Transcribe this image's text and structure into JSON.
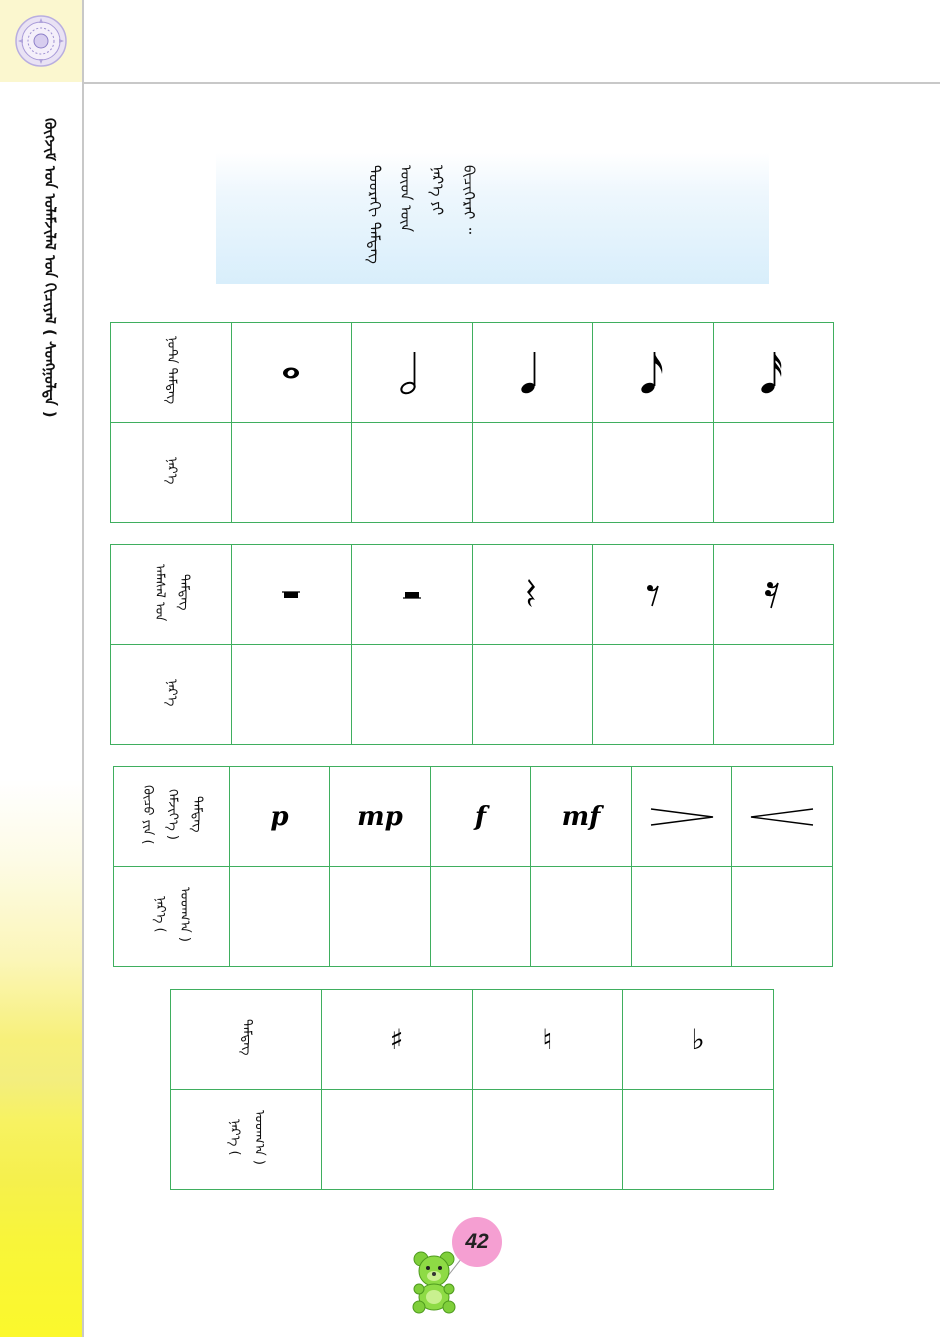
{
  "page": {
    "side_title": "ᠬᠥᠭᠵᠢᠮ ᠤᠨ ᠤᠯᠠᠮᠵᠢᠯᠠᠯ ᠤᠨ ᠬᠢᠴᠢᠶᠡᠯ ( ᠰᠣᠩᠭᠣᠯᠲᠠ )",
    "instruction": "ᠳᠣᠣᠷᠠᠬᠢ ᠲᠡᠮᠳᠡᠭ ᠦᠳ ᠦᠨ ᠨᠡᠷ᠎ᠡ ᠶᠢ ᠪᠢᠴᠢᠭᠡᠷᠡᠢ ᠃",
    "page_number": "42",
    "accent_color": "#3fae5e",
    "badge_color": "#f59fd2"
  },
  "tables": {
    "notes": {
      "header_label": "ᠨᠤᠲ᠋ᠠ ᠲᠡᠮᠳᠡᠭ",
      "name_label": "ᠨᠡᠷ᠎ᠡ",
      "symbols": [
        "whole-note",
        "half-note",
        "quarter-note",
        "eighth-note",
        "sixteenth-note"
      ]
    },
    "rests": {
      "header_label": "ᠠᠮᠠᠰᠠᠯ ᠤᠨ ᠲᠡᠮᠳᠡᠭ",
      "name_label": "ᠨᠡᠷ᠎ᠡ",
      "symbols": [
        "whole-rest",
        "half-rest",
        "quarter-rest",
        "eighth-rest",
        "sixteenth-rest"
      ]
    },
    "dynamics": {
      "header_label": "ᠬᠦᠴᠦ ᠶᠢᠨ ( ᠬᠡᠮᠵᠢᠶ᠎ᠡ ) ᠲᠡᠮᠳᠡᠭ",
      "name_label": "ᠨᠡᠷ᠎ᠡ ( ᠤᠳᠬ᠎ᠠ )",
      "marks": [
        "p",
        "mp",
        "f",
        "mf"
      ],
      "symbols": [
        "decrescendo-hairpin",
        "crescendo-hairpin"
      ]
    },
    "accidentals": {
      "header_label": "ᠲᠡᠮᠳᠡᠭ",
      "name_label": "ᠨᠡᠷ᠎ᠡ ( ᠤᠳᠬ᠎ᠠ )",
      "marks": [
        "♯",
        "♮",
        "♭"
      ]
    }
  }
}
